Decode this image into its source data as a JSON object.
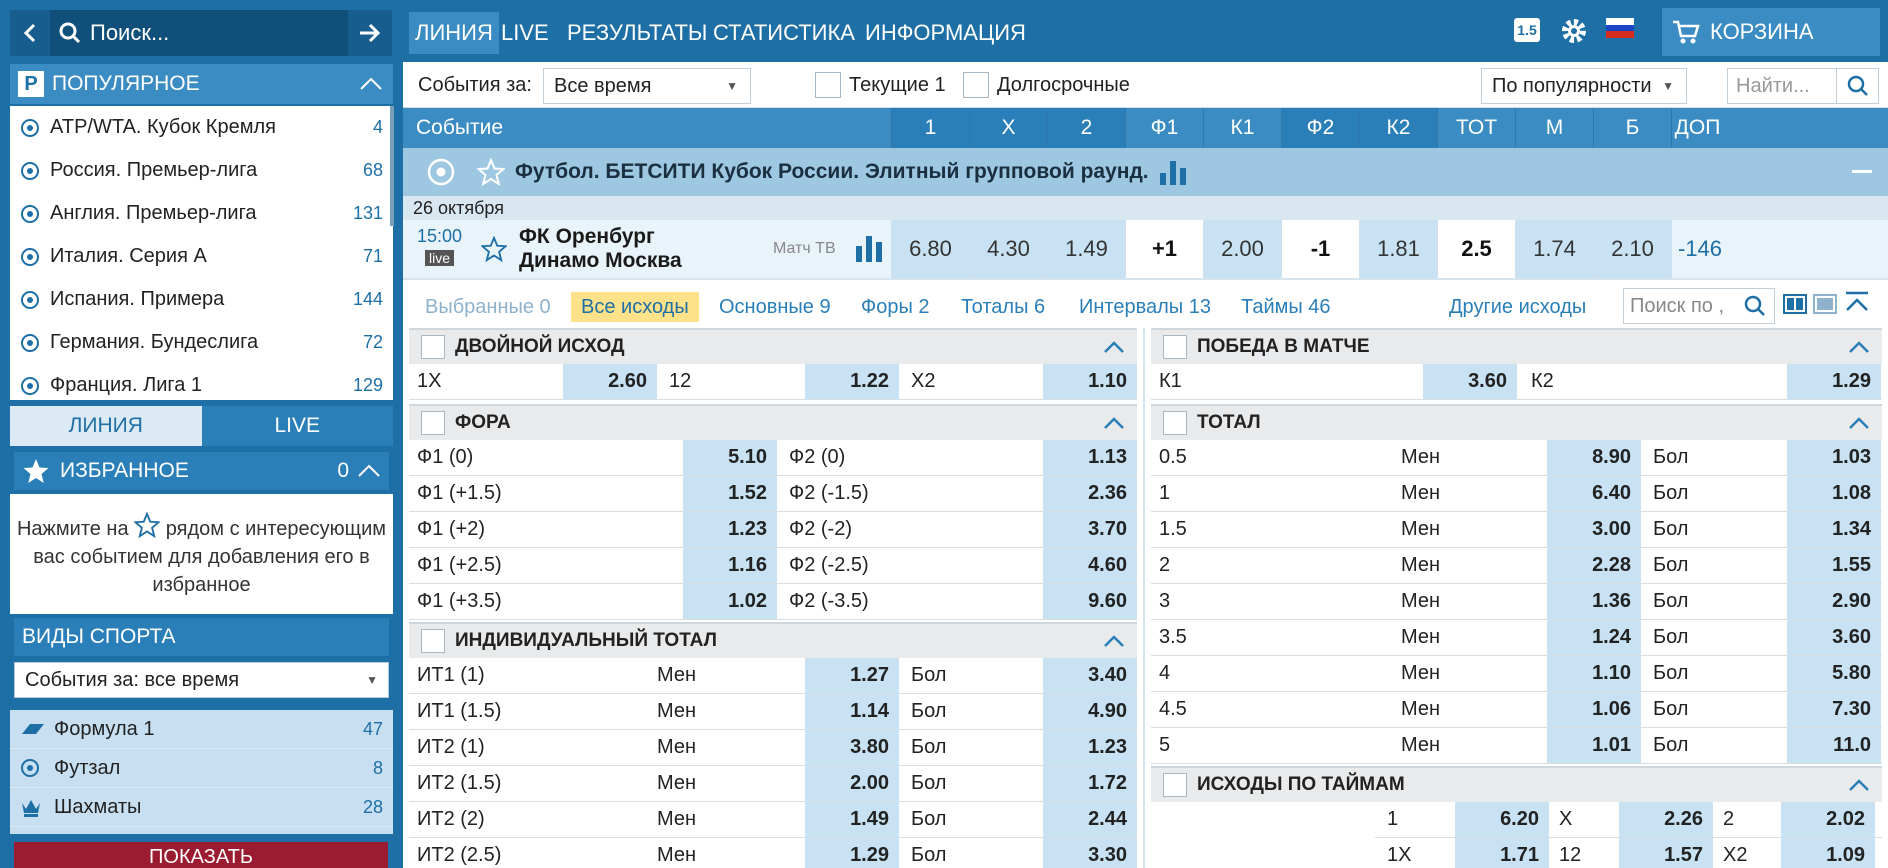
{
  "search": {
    "placeholder": "Поиск..."
  },
  "popular": {
    "title": "ПОПУЛЯРНОЕ",
    "items": [
      {
        "label": "ATP/WTA. Кубок Кремля",
        "count": "4"
      },
      {
        "label": "Россия. Премьер-лига",
        "count": "68"
      },
      {
        "label": "Англия. Премьер-лига",
        "count": "131"
      },
      {
        "label": "Италия. Серия А",
        "count": "71"
      },
      {
        "label": "Испания. Примера",
        "count": "144"
      },
      {
        "label": "Германия. Бундеслига",
        "count": "72"
      },
      {
        "label": "Франция. Лига 1",
        "count": "129"
      }
    ]
  },
  "side_tabs": {
    "line": "ЛИНИЯ",
    "live": "LIVE"
  },
  "favorites": {
    "title": "ИЗБРАННОЕ",
    "count": "0",
    "hint_pre": "Нажмите на",
    "hint_post": "рядом с интересующим вас событием для добавления его в избранное"
  },
  "sports": {
    "title": "ВИДЫ СПОРТА",
    "filter": "События за: все время",
    "items": [
      {
        "label": "Формула 1",
        "count": "47"
      },
      {
        "label": "Футзал",
        "count": "8"
      },
      {
        "label": "Шахматы",
        "count": "28"
      }
    ],
    "show_button": "ПОКАЗАТЬ"
  },
  "nav": {
    "items": [
      "ЛИНИЯ",
      "LIVE",
      "РЕЗУЛЬТАТЫ",
      "СТАТИСТИКА",
      "ИНФОРМАЦИЯ"
    ],
    "version_badge": "1.5",
    "cart": "КОРЗИНА"
  },
  "filter": {
    "events_for_label": "События за:",
    "period": "Все время",
    "current_label": "Текущие 1",
    "long_term_label": "Долгосрочные",
    "sort": "По популярности",
    "find_placeholder": "Найти..."
  },
  "columns": {
    "event": "Событие",
    "c1": "1",
    "cx": "X",
    "c2": "2",
    "f1": "Ф1",
    "k1": "К1",
    "f2": "Ф2",
    "k2": "К2",
    "tot": "ТОТ",
    "m": "М",
    "b": "Б",
    "dop": "ДОП"
  },
  "competition": {
    "title": "Футбол. БЕТСИТИ Кубок России. Элитный групповой раунд.",
    "date": "26 октября"
  },
  "match": {
    "time": "15:00",
    "live_badge": "live",
    "team1": "ФК Оренбург",
    "team2": "Динамо Москва",
    "tv": "Матч ТВ",
    "odds": {
      "w1": "6.80",
      "x": "4.30",
      "w2": "1.49",
      "f1": "+1",
      "k1": "2.00",
      "f2": "-1",
      "k2": "1.81",
      "tot": "2.5",
      "m": "1.74",
      "b": "2.10",
      "more": "-146"
    }
  },
  "subtabs": {
    "selected": "Выбранные 0",
    "all": "Все исходы",
    "main": "Основные 9",
    "handicaps": "Форы 2",
    "totals": "Тоталы 6",
    "intervals": "Интервалы 13",
    "halves": "Таймы 46",
    "other": "Другие исходы",
    "search_placeholder": "Поиск по ,"
  },
  "markets": {
    "double": {
      "title": "ДВОЙНОЙ ИСХОД",
      "r": [
        "1X",
        "2.60",
        "12",
        "1.22",
        "X2",
        "1.10"
      ]
    },
    "handicap": {
      "title": "ФОРА",
      "rows": [
        [
          "Ф1 (0)",
          "5.10",
          "Ф2 (0)",
          "1.13"
        ],
        [
          "Ф1 (+1.5)",
          "1.52",
          "Ф2 (-1.5)",
          "2.36"
        ],
        [
          "Ф1 (+2)",
          "1.23",
          "Ф2 (-2)",
          "3.70"
        ],
        [
          "Ф1 (+2.5)",
          "1.16",
          "Ф2 (-2.5)",
          "4.60"
        ],
        [
          "Ф1 (+3.5)",
          "1.02",
          "Ф2 (-3.5)",
          "9.60"
        ]
      ]
    },
    "ind_total": {
      "title": "ИНДИВИДУАЛЬНЫЙ ТОТАЛ",
      "rows": [
        [
          "ИТ1 (1)",
          "Мен",
          "1.27",
          "Бол",
          "3.40"
        ],
        [
          "ИТ1 (1.5)",
          "Мен",
          "1.14",
          "Бол",
          "4.90"
        ],
        [
          "ИТ2 (1)",
          "Мен",
          "3.80",
          "Бол",
          "1.23"
        ],
        [
          "ИТ2 (1.5)",
          "Мен",
          "2.00",
          "Бол",
          "1.72"
        ],
        [
          "ИТ2 (2)",
          "Мен",
          "1.49",
          "Бол",
          "2.44"
        ],
        [
          "ИТ2 (2.5)",
          "Мен",
          "1.29",
          "Бол",
          "3.30"
        ]
      ]
    },
    "win": {
      "title": "ПОБЕДА В МАТЧЕ",
      "r": [
        "К1",
        "3.60",
        "К2",
        "1.29"
      ]
    },
    "total": {
      "title": "ТОТАЛ",
      "rows": [
        [
          "0.5",
          "Мен",
          "8.90",
          "Бол",
          "1.03"
        ],
        [
          "1",
          "Мен",
          "6.40",
          "Бол",
          "1.08"
        ],
        [
          "1.5",
          "Мен",
          "3.00",
          "Бол",
          "1.34"
        ],
        [
          "2",
          "Мен",
          "2.28",
          "Бол",
          "1.55"
        ],
        [
          "3",
          "Мен",
          "1.36",
          "Бол",
          "2.90"
        ],
        [
          "3.5",
          "Мен",
          "1.24",
          "Бол",
          "3.60"
        ],
        [
          "4",
          "Мен",
          "1.10",
          "Бол",
          "5.80"
        ],
        [
          "4.5",
          "Мен",
          "1.06",
          "Бол",
          "7.30"
        ],
        [
          "5",
          "Мен",
          "1.01",
          "Бол",
          "11.0"
        ]
      ]
    },
    "halves": {
      "title": "ИСХОДЫ ПО ТАЙМАМ",
      "rows": [
        [
          "1",
          "6.20",
          "X",
          "2.26",
          "2",
          "2.02"
        ],
        [
          "1X",
          "1.71",
          "12",
          "1.57",
          "X2",
          "1.09"
        ]
      ]
    }
  }
}
